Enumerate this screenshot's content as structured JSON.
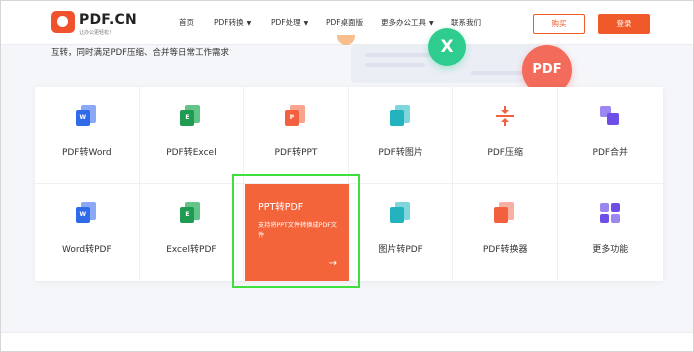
{
  "header": {
    "logo_title": "PDF.CN",
    "logo_subtitle": "让办公更轻松！",
    "nav": [
      {
        "label": "首页",
        "has_caret": false
      },
      {
        "label": "PDF转换",
        "has_caret": true
      },
      {
        "label": "PDF处理",
        "has_caret": true
      },
      {
        "label": "PDF桌面版",
        "has_caret": false
      },
      {
        "label": "更多办公工具",
        "has_caret": true
      },
      {
        "label": "联系我们",
        "has_caret": false
      }
    ],
    "buy_label": "购买",
    "login_label": "登录"
  },
  "hero": {
    "text": "互转，同时满足PDF压缩、合并等日常工作需求",
    "badge_x": "X",
    "badge_pdf": "PDF"
  },
  "tools": [
    {
      "label": "PDF转Word",
      "icon": "word-icon",
      "glyph": "W",
      "kind": "word"
    },
    {
      "label": "PDF转Excel",
      "icon": "excel-icon",
      "glyph": "E",
      "kind": "excel"
    },
    {
      "label": "PDF转PPT",
      "icon": "ppt-icon",
      "glyph": "P",
      "kind": "ppt"
    },
    {
      "label": "PDF转图片",
      "icon": "image-icon",
      "glyph": "",
      "kind": "img"
    },
    {
      "label": "PDF压缩",
      "icon": "compress-icon",
      "glyph": "",
      "kind": "compress"
    },
    {
      "label": "PDF合并",
      "icon": "merge-icon",
      "glyph": "",
      "kind": "merge"
    },
    {
      "label": "Word转PDF",
      "icon": "word-icon",
      "glyph": "W",
      "kind": "word"
    },
    {
      "label": "Excel转PDF",
      "icon": "excel-icon",
      "glyph": "E",
      "kind": "excel"
    },
    {
      "label": "PPT转PDF",
      "icon": "ppt-icon",
      "glyph": "P",
      "kind": "ppt"
    },
    {
      "label": "图片转PDF",
      "icon": "image-icon",
      "glyph": "",
      "kind": "img"
    },
    {
      "label": "PDF转换器",
      "icon": "converter-icon",
      "glyph": "",
      "kind": "converter"
    },
    {
      "label": "更多功能",
      "icon": "grid-icon",
      "glyph": "",
      "kind": "more"
    }
  ],
  "active_card": {
    "title": "PPT转PDF",
    "description": "支持将PPT文件转换成PDF文件",
    "arrow": "→"
  },
  "colors": {
    "accent": "#f05a2a",
    "highlight_outline": "#3de03d"
  }
}
